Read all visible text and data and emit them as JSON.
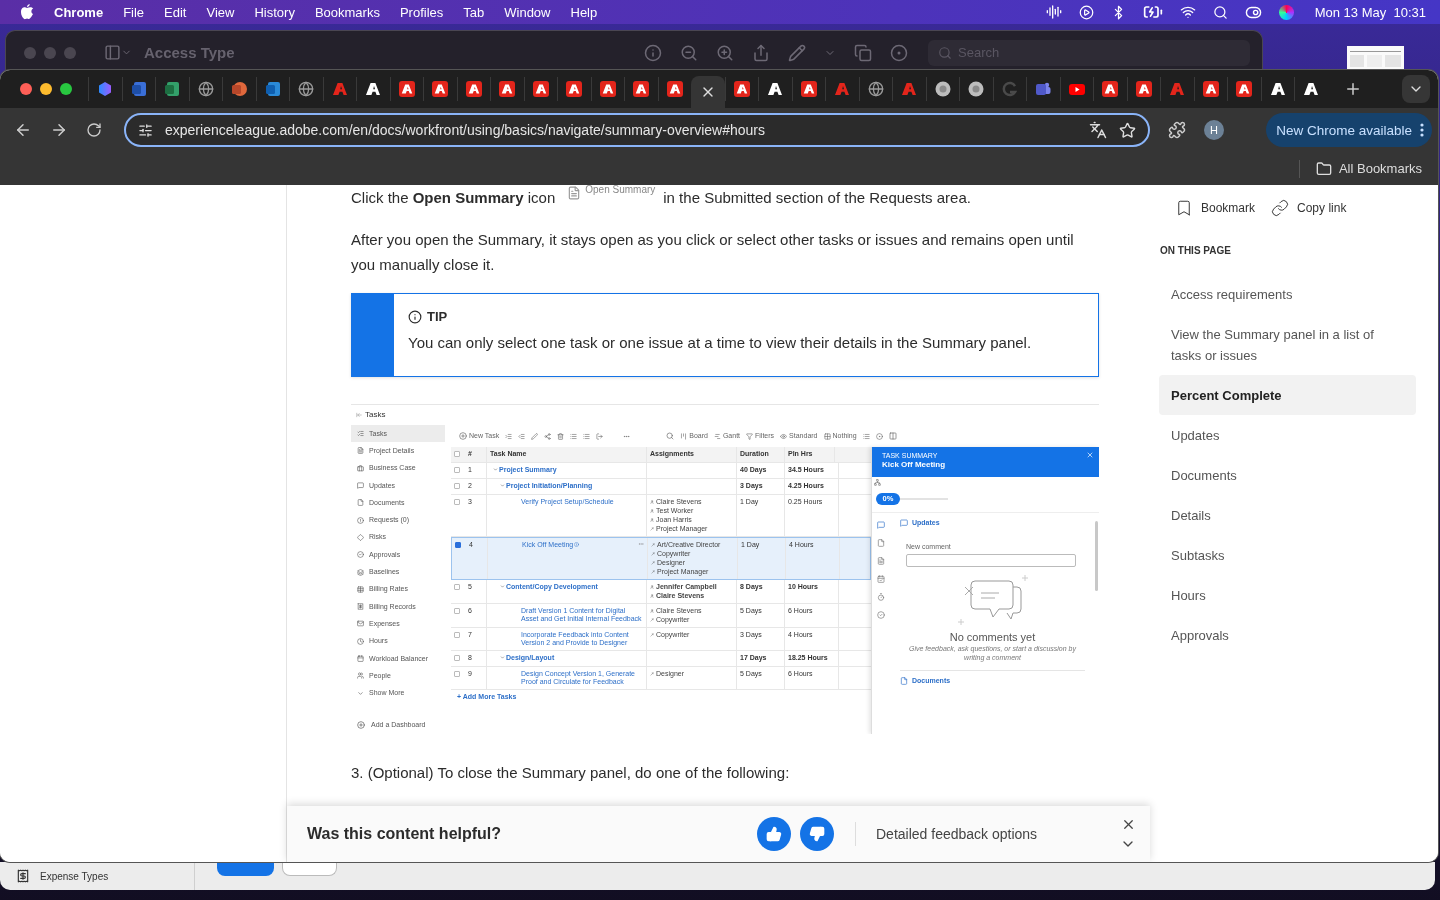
{
  "menu_bar": {
    "app": "Chrome",
    "menus": [
      "File",
      "Edit",
      "View",
      "History",
      "Bookmarks",
      "Profiles",
      "Tab",
      "Window",
      "Help"
    ],
    "clock": "Mon 13 May  10:31"
  },
  "background_window": {
    "title": "Access Type",
    "search_placeholder": "Search",
    "sidebar_item": "Expense Types"
  },
  "browser": {
    "tabs": [
      {
        "kind": "copilot",
        "selected": false
      },
      {
        "kind": "visio",
        "selected": false
      },
      {
        "kind": "excel",
        "selected": false
      },
      {
        "kind": "globe",
        "selected": false
      },
      {
        "kind": "powerpoint",
        "selected": false
      },
      {
        "kind": "outlook",
        "selected": false
      },
      {
        "kind": "globe",
        "selected": false
      },
      {
        "kind": "adobe-outline",
        "selected": false
      },
      {
        "kind": "adobe-white",
        "selected": false
      },
      {
        "kind": "adobe",
        "selected": false
      },
      {
        "kind": "adobe",
        "selected": false
      },
      {
        "kind": "adobe",
        "selected": false
      },
      {
        "kind": "adobe",
        "selected": false
      },
      {
        "kind": "adobe",
        "selected": false
      },
      {
        "kind": "adobe",
        "selected": false
      },
      {
        "kind": "adobe",
        "selected": false
      },
      {
        "kind": "adobe",
        "selected": false
      },
      {
        "kind": "adobe",
        "selected": false
      },
      {
        "selected": true
      },
      {
        "kind": "adobe",
        "selected": false
      },
      {
        "kind": "adobe-white",
        "selected": false
      },
      {
        "kind": "adobe",
        "selected": false
      },
      {
        "kind": "adobe-outline",
        "selected": false
      },
      {
        "kind": "globe",
        "selected": false
      },
      {
        "kind": "adobe-outline",
        "selected": false
      },
      {
        "kind": "round",
        "selected": false
      },
      {
        "kind": "round",
        "selected": false
      },
      {
        "kind": "dim",
        "selected": false
      },
      {
        "kind": "teams",
        "selected": false
      },
      {
        "kind": "youtube",
        "selected": false
      },
      {
        "kind": "adobe",
        "selected": false
      },
      {
        "kind": "adobe",
        "selected": false
      },
      {
        "kind": "adobe-outline",
        "selected": false
      },
      {
        "kind": "adobe",
        "selected": false
      },
      {
        "kind": "adobe",
        "selected": false
      },
      {
        "kind": "adobe-white",
        "selected": false
      },
      {
        "kind": "adobe-white",
        "selected": false
      }
    ],
    "url": "experienceleague.adobe.com/en/docs/workfront/using/basics/navigate/summary-overview#hours",
    "avatar": "H",
    "update_button": "New Chrome available",
    "bookmarks_label": "All Bookmarks"
  },
  "article": {
    "intro_before": "Click the **Open Summary** icon",
    "inline_image_label": "Open Summary",
    "intro_after": "in the Submitted section of the Requests area.",
    "paragraph": "After you open the Summary, it stays open as you click or select other tasks or issues and remains open until you manually close it.",
    "tip": {
      "label": "TIP",
      "text": "You can only select one task or one issue at a time to view their details in the Summary panel."
    },
    "screenshot": {
      "header": "Tasks",
      "nav": [
        {
          "label": "Tasks",
          "selected": true
        },
        {
          "label": "Project Details",
          "selected": false
        },
        {
          "label": "Business Case",
          "selected": false
        },
        {
          "label": "Updates",
          "selected": false
        },
        {
          "label": "Documents",
          "selected": false
        },
        {
          "label": "Requests (0)",
          "selected": false
        },
        {
          "label": "Risks",
          "selected": false
        },
        {
          "label": "Approvals",
          "selected": false
        },
        {
          "label": "Baselines",
          "selected": false
        },
        {
          "label": "Billing Rates",
          "selected": false
        },
        {
          "label": "Billing Records",
          "selected": false
        },
        {
          "label": "Expenses",
          "selected": false
        },
        {
          "label": "Hours",
          "selected": false
        },
        {
          "label": "Workload Balancer",
          "selected": false
        },
        {
          "label": "People",
          "selected": false
        },
        {
          "label": "Show More",
          "selected": false
        }
      ],
      "nav_footer": "Add a Dashboard",
      "new_task": "New Task",
      "views": [
        {
          "kind": "board",
          "label": "Board"
        },
        {
          "kind": "gantt",
          "label": "Gantt"
        },
        {
          "kind": "filter",
          "label": "Filters"
        },
        {
          "kind": "standard",
          "label": "Standard"
        },
        {
          "kind": "grouping",
          "label": "Nothing"
        }
      ],
      "all_selected": false,
      "columns": [
        "#",
        "Task Name",
        "Assignments",
        "Duration",
        "Pln Hrs"
      ],
      "tasks": [
        {
          "number": "1",
          "name": "Project Summary",
          "duration": "40 Days",
          "planned_hours": "34.5 Hours",
          "selected": false,
          "expanded": true,
          "children": [
            {
              "number": "2",
              "name": "Project Initiation/Planning",
              "duration": "3 Days",
              "planned_hours": "4.25 Hours",
              "selected": false,
              "expanded": true,
              "children": [
                {
                  "number": "3",
                  "name": "Verify Project Setup/Schedule",
                  "assignments": [
                    {
                      "kind": "user",
                      "name": "Claire Stevens"
                    },
                    {
                      "kind": "user",
                      "name": "Test Worker"
                    },
                    {
                      "kind": "user",
                      "name": "Joan Harris"
                    },
                    {
                      "kind": "role",
                      "name": "Project Manager"
                    }
                  ],
                  "duration": "1 Day",
                  "planned_hours": "0.25 Hours",
                  "selected": false
                },
                {
                  "number": "4",
                  "name": "Kick Off Meeting",
                  "assignments": [
                    {
                      "kind": "role",
                      "name": "Art/Creative Director"
                    },
                    {
                      "kind": "role",
                      "name": "Copywriter"
                    },
                    {
                      "kind": "role",
                      "name": "Designer"
                    },
                    {
                      "kind": "role",
                      "name": "Project Manager"
                    }
                  ],
                  "duration": "1 Day",
                  "planned_hours": "4 Hours",
                  "selected": true
                }
              ]
            },
            {
              "number": "5",
              "name": "Content/Copy Development",
              "assignments": [
                {
                  "kind": "user",
                  "name": "Jennifer Campbell"
                },
                {
                  "kind": "user",
                  "name": "Claire Stevens"
                }
              ],
              "duration": "8 Days",
              "planned_hours": "10 Hours",
              "selected": false,
              "expanded": true,
              "children": [
                {
                  "number": "6",
                  "name": "Draft Version 1 Content for Digital Asset and Get Initial Internal Feedback",
                  "assignments": [
                    {
                      "kind": "user",
                      "name": "Claire Stevens"
                    },
                    {
                      "kind": "role",
                      "name": "Copywriter"
                    }
                  ],
                  "duration": "5 Days",
                  "planned_hours": "6 Hours",
                  "selected": false
                },
                {
                  "number": "7",
                  "name": "Incorporate Feedback into Content Version 2 and Provide to Designer",
                  "assignments": [
                    {
                      "kind": "role",
                      "name": "Copywriter"
                    }
                  ],
                  "duration": "3 Days",
                  "planned_hours": "4 Hours",
                  "selected": false
                }
              ]
            },
            {
              "number": "8",
              "name": "Design/Layout",
              "duration": "17 Days",
              "planned_hours": "18.25 Hours",
              "selected": false,
              "expanded": true,
              "children": [
                {
                  "number": "9",
                  "name": "Design Concept Version 1, Generate Proof and Circulate for Feedback",
                  "assignments": [
                    {
                      "kind": "role",
                      "name": "Designer"
                    }
                  ],
                  "duration": "5 Days",
                  "planned_hours": "6 Hours",
                  "selected": false
                }
              ]
            }
          ]
        }
      ],
      "add_more": "+ Add More Tasks",
      "summary": {
        "eyebrow": "TASK SUMMARY",
        "title": "Kick Off Meeting",
        "progress": {
          "label": "0%",
          "level": 0
        },
        "section": "Updates",
        "comment_label": "New comment",
        "empty_title": "No comments yet",
        "empty_text": "Give feedback, ask questions, or start a discussion by writing a comment",
        "next_section": "Documents"
      }
    },
    "step": "3. (Optional) To close the Summary panel, do one of the following:"
  },
  "page_actions": [
    {
      "kind": "bookmark",
      "label": "Bookmark"
    },
    {
      "kind": "link",
      "label": "Copy link"
    }
  ],
  "toc": {
    "heading": "ON THIS PAGE",
    "items": [
      {
        "label": "Access requirements",
        "selected": false
      },
      {
        "label": "View the Summary panel in a list of tasks or issues",
        "selected": false
      },
      {
        "label": "Percent Complete",
        "selected": true
      },
      {
        "label": "Updates",
        "selected": false
      },
      {
        "label": "Documents",
        "selected": false
      },
      {
        "label": "Details",
        "selected": false
      },
      {
        "label": "Subtasks",
        "selected": false
      },
      {
        "label": "Hours",
        "selected": false
      },
      {
        "label": "Approvals",
        "selected": false
      }
    ]
  },
  "feedback": {
    "question": "Was this content helpful?",
    "options_label": "Detailed feedback options"
  }
}
